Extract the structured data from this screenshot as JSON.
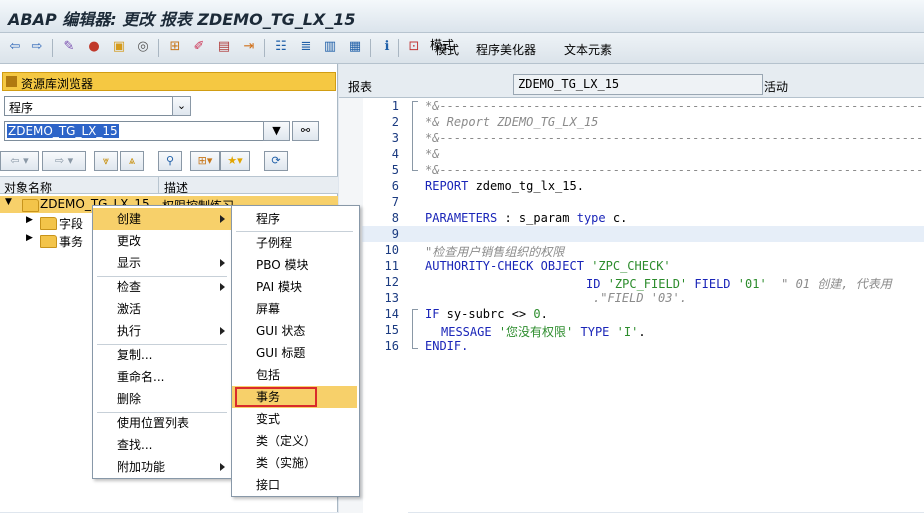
{
  "window": {
    "title": "ABAP 编辑器: 更改 报表 ZDEMO_TG_LX_15"
  },
  "toolbar": {
    "mode": "模式",
    "pretty_printer": "程序美化器",
    "text_elements": "文本元素"
  },
  "left": {
    "repo_header": "资源库浏览器",
    "object_type": "程序",
    "object_name": "ZDEMO_TG_LX_15",
    "col_object": "对象名称",
    "col_desc": "描述",
    "tree": [
      {
        "label": "ZDEMO_TG_LX_15",
        "desc": "权限控制练习"
      },
      {
        "label": "字段"
      },
      {
        "label": "事务"
      }
    ]
  },
  "right": {
    "type_label": "报表",
    "program_name": "ZDEMO_TG_LX_15",
    "status": "活动"
  },
  "code": [
    {
      "n": "1"
    },
    {
      "n": "2"
    },
    {
      "n": "3"
    },
    {
      "n": "4"
    },
    {
      "n": "5"
    },
    {
      "n": "6"
    },
    {
      "n": "7"
    },
    {
      "n": "8"
    },
    {
      "n": "9"
    },
    {
      "n": "10"
    },
    {
      "n": "11"
    },
    {
      "n": "12"
    },
    {
      "n": "13"
    },
    {
      "n": "14"
    },
    {
      "n": "15"
    },
    {
      "n": "16"
    }
  ],
  "code_text": {
    "l1": "*&---------------------------------------------------------------------",
    "l2": "*& Report ZDEMO_TG_LX_15",
    "l3": "*&---------------------------------------------------------------------",
    "l4": "*&",
    "l5": "*&---------------------------------------------------------------------",
    "l6a": "REPORT",
    "l6b": " zdemo_tg_lx_15.",
    "l8a": "PARAMETERS",
    "l8b": " : s_param ",
    "l8c": "type",
    "l8d": " c.",
    "l10": "\"检查用户销售组织的权限",
    "l11a": "AUTHORITY-CHECK OBJECT",
    "l11b": "'ZPC_CHECK'",
    "l12a": "ID",
    "l12b": "'ZPC_FIELD'",
    "l12c": "FIELD",
    "l12d": "'01'",
    "l12e": "\" 01 创建, 代表用",
    "l13": ".\"FIELD '03'.",
    "l15a": "IF",
    "l15b": " sy-subrc <> ",
    "l15c": "0",
    "l15d": ".",
    "l16a": "MESSAGE",
    "l16b": "'您没有权限'",
    "l16c": "TYPE",
    "l16d": "'I'",
    "l16e": ".",
    "l17": "ENDIF."
  },
  "context_menu": [
    {
      "label": "创建",
      "submenu": true
    },
    {
      "label": "更改"
    },
    {
      "label": "显示",
      "submenu": true
    },
    {
      "label": "检查",
      "submenu": true
    },
    {
      "label": "激活"
    },
    {
      "label": "执行",
      "submenu": true
    },
    {
      "label": "复制..."
    },
    {
      "label": "重命名..."
    },
    {
      "label": "删除"
    },
    {
      "label": "使用位置列表"
    },
    {
      "label": "查找..."
    },
    {
      "label": "附加功能",
      "submenu": true
    }
  ],
  "submenu": [
    {
      "label": "程序"
    },
    {
      "label": "子例程"
    },
    {
      "label": "PBO 模块"
    },
    {
      "label": "PAI 模块"
    },
    {
      "label": "屏幕"
    },
    {
      "label": "GUI 状态"
    },
    {
      "label": "GUI 标题"
    },
    {
      "label": "包括"
    },
    {
      "label": "事务"
    },
    {
      "label": "变式"
    },
    {
      "label": "类（定义）"
    },
    {
      "label": "类（实施）"
    },
    {
      "label": "接口"
    }
  ]
}
